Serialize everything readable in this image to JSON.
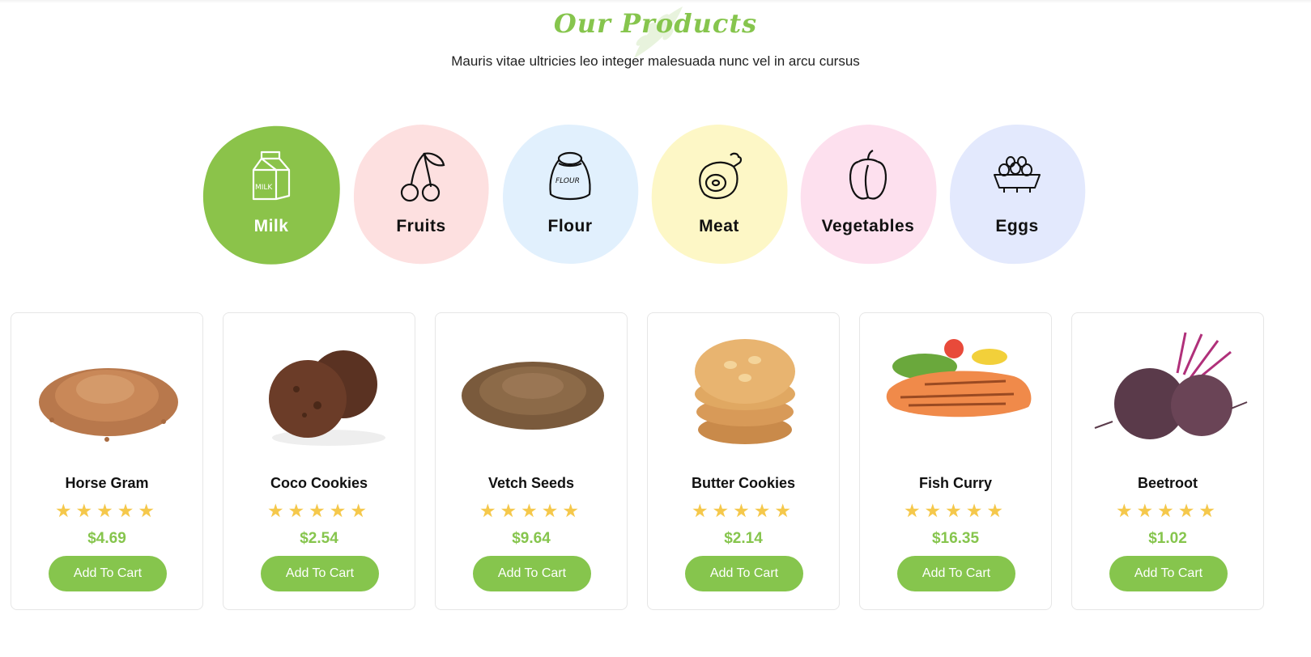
{
  "section": {
    "title": "Our Products",
    "subtitle": "Mauris vitae ultricies leo integer malesuada nunc vel in arcu cursus"
  },
  "categories": [
    {
      "label": "Milk",
      "icon": "milk-carton-icon",
      "color": "#8bc34a",
      "active": true
    },
    {
      "label": "Fruits",
      "icon": "cherry-icon",
      "color": "#fde0e0",
      "active": false
    },
    {
      "label": "Flour",
      "icon": "flour-sack-icon",
      "color": "#e1f0fd",
      "active": false
    },
    {
      "label": "Meat",
      "icon": "ham-leg-icon",
      "color": "#fdf7c6",
      "active": false
    },
    {
      "label": "Vegetables",
      "icon": "bell-pepper-icon",
      "color": "#fde0ee",
      "active": false
    },
    {
      "label": "Eggs",
      "icon": "egg-carton-icon",
      "color": "#e3e9fd",
      "active": false
    }
  ],
  "products": [
    {
      "name": "Horse Gram",
      "price": "$4.69",
      "rating": 5,
      "stars": "★★★★★",
      "cta": "Add To Cart",
      "image": "horse-gram-image"
    },
    {
      "name": "Coco Cookies",
      "price": "$2.54",
      "rating": 5,
      "stars": "★★★★★",
      "cta": "Add To Cart",
      "image": "coco-cookies-image"
    },
    {
      "name": "Vetch Seeds",
      "price": "$9.64",
      "rating": 5,
      "stars": "★★★★★",
      "cta": "Add To Cart",
      "image": "vetch-seeds-image"
    },
    {
      "name": "Butter Cookies",
      "price": "$2.14",
      "rating": 5,
      "stars": "★★★★★",
      "cta": "Add To Cart",
      "image": "butter-cookies-image"
    },
    {
      "name": "Fish Curry",
      "price": "$16.35",
      "rating": 5,
      "stars": "★★★★★",
      "cta": "Add To Cart",
      "image": "fish-curry-image"
    },
    {
      "name": "Beetroot",
      "price": "$1.02",
      "rating": 5,
      "stars": "★★★★★",
      "cta": "Add To Cart",
      "image": "beetroot-image"
    }
  ],
  "colors": {
    "accent": "#86c54d",
    "star": "#f5c84b",
    "text": "#111111"
  }
}
